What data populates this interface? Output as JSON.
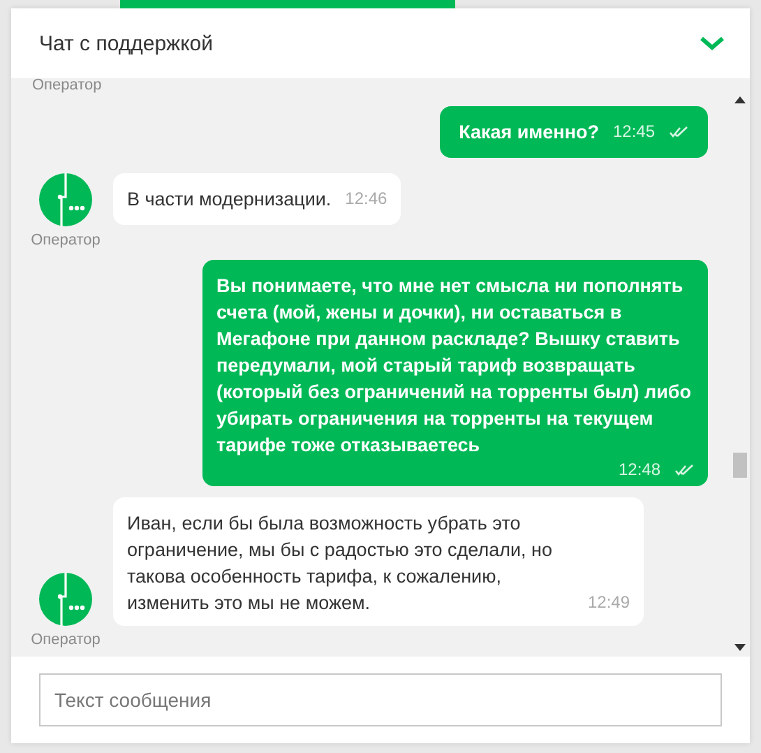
{
  "header": {
    "title": "Чат с поддержкой"
  },
  "chat": {
    "top_label": "Оператор",
    "messages": [
      {
        "kind": "user",
        "text": "Какая именно?",
        "time": "12:45",
        "read": true
      },
      {
        "kind": "operator",
        "text": "В части модернизации.",
        "time": "12:46",
        "sender": "Оператор"
      },
      {
        "kind": "user",
        "text": "Вы понимаете, что мне нет смысла ни пополнять счета (мой, жены и дочки), ни оставаться в Мегафоне при данном раскладе? Вышку ставить передумали, мой старый тариф возвращать (который без ограничений на торренты был) либо убирать ограничения на торренты на текущем тарифе тоже отказываетесь",
        "time": "12:48",
        "read": true
      },
      {
        "kind": "operator",
        "text": "Иван, если бы была возможность убрать это ограничение, мы бы с радостью это сделали, но такова особенность тарифа, к сожалению, изменить это мы не можем.",
        "time": "12:49",
        "sender": "Оператор"
      }
    ]
  },
  "composer": {
    "placeholder": "Текст сообщения"
  }
}
